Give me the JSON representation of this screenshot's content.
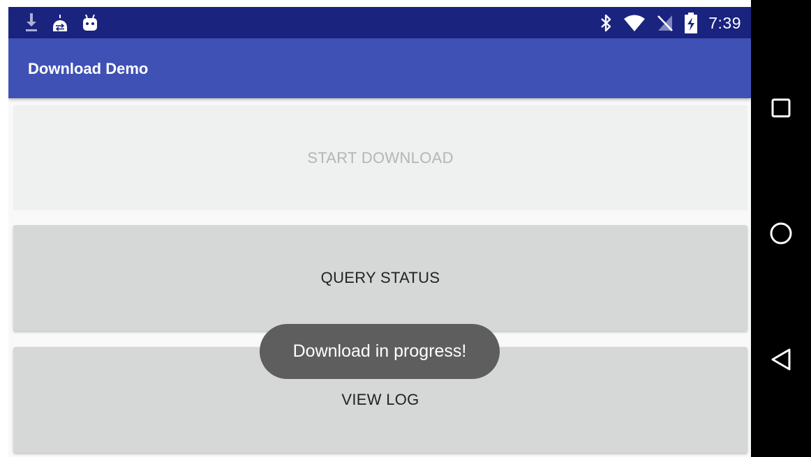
{
  "status_bar": {
    "time": "7:39",
    "left_icons": [
      "download-icon",
      "android-sync-icon",
      "android-debug-icon"
    ],
    "right_icons": [
      "bluetooth-icon",
      "wifi-icon",
      "no-sim-icon",
      "battery-charging-icon"
    ],
    "background": "#1a237e"
  },
  "app_bar": {
    "title": "Download Demo",
    "background": "#3f51b5"
  },
  "buttons": {
    "start_download": "START DOWNLOAD",
    "query_status": "QUERY STATUS",
    "view_log": "VIEW LOG"
  },
  "toast": {
    "message": "Download in progress!"
  },
  "nav_bar": {
    "icons": [
      "recent-apps-icon",
      "home-icon",
      "back-icon"
    ]
  }
}
